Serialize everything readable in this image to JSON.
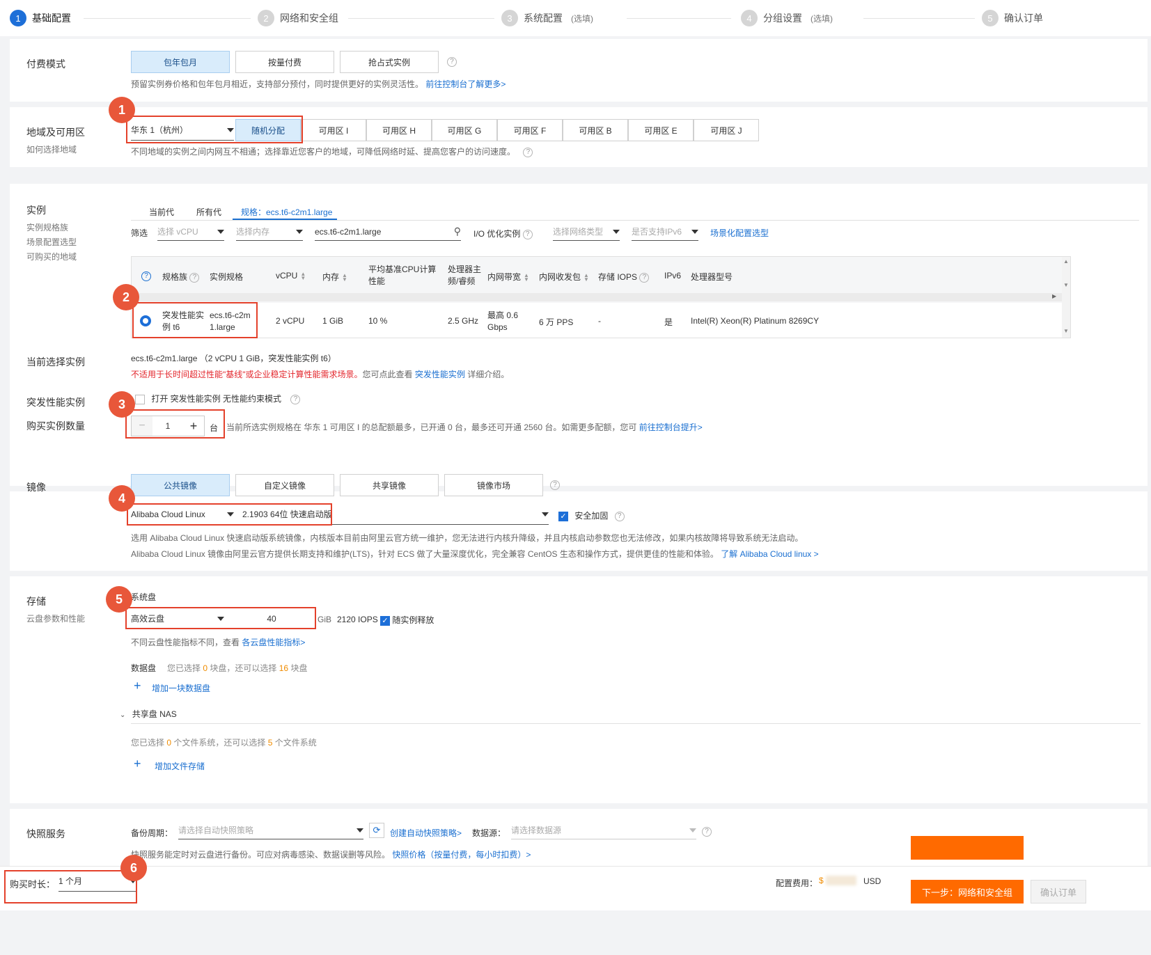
{
  "steps": [
    {
      "num": "1",
      "label": "基础配置",
      "optional": ""
    },
    {
      "num": "2",
      "label": "网络和安全组",
      "optional": ""
    },
    {
      "num": "3",
      "label": "系统配置",
      "optional": "(选填)"
    },
    {
      "num": "4",
      "label": "分组设置",
      "optional": "(选填)"
    },
    {
      "num": "5",
      "label": "确认订单",
      "optional": ""
    }
  ],
  "badges": [
    "1",
    "2",
    "3",
    "4",
    "5",
    "6"
  ],
  "billing": {
    "label": "付费模式",
    "options": [
      "包年包月",
      "按量付费",
      "抢占式实例"
    ],
    "hint": "预留实例券价格和包年包月相近，支持部分预付，同时提供更好的实例灵活性。",
    "hint_link": "前往控制台了解更多>"
  },
  "region": {
    "label": "地域及可用区",
    "sublabel": "如何选择地域",
    "region_value": "华东 1（杭州）",
    "zones": [
      "随机分配",
      "可用区 I",
      "可用区 H",
      "可用区 G",
      "可用区 F",
      "可用区 B",
      "可用区 E",
      "可用区 J"
    ],
    "hint": "不同地域的实例之间内网互不相通；选择靠近您客户的地域，可降低网络时延、提高您客户的访问速度。"
  },
  "instance": {
    "label": "实例",
    "sublabels": [
      "实例规格族",
      "场景配置选型",
      "可购买的地域"
    ],
    "tabs": [
      "当前代",
      "所有代",
      "规格：ecs.t6-c2m1.large"
    ],
    "filter_label": "筛选",
    "filter_vcpu": "选择 vCPU",
    "filter_mem": "选择内存",
    "search_value": "ecs.t6-c2m1.large",
    "io_label": "I/O 优化实例",
    "filter_net": "选择网络类型",
    "filter_ipv6": "是否支持IPv6",
    "scene_link": "场景化配置选型",
    "columns": [
      "规格族",
      "实例规格",
      "vCPU",
      "内存",
      "平均基准CPU计算性能",
      "处理器主频/睿频",
      "内网带宽",
      "内网收发包",
      "存储 IOPS",
      "IPv6",
      "处理器型号"
    ],
    "row": {
      "family": "突发性能实例 t6",
      "spec": "ecs.t6-c2m1.large",
      "vcpu": "2 vCPU",
      "mem": "1 GiB",
      "baseline": "10 %",
      "freq": "2.5 GHz",
      "bandwidth": "最高 0.6 Gbps",
      "pps": "6 万 PPS",
      "iops": "-",
      "ipv6": "是",
      "cpu": "Intel(R) Xeon(R) Platinum 8269CY"
    }
  },
  "current": {
    "label": "当前选择实例",
    "value": "ecs.t6-c2m1.large （2 vCPU 1 GiB，突发性能实例 t6）",
    "warn": "不适用于长时间超过性能\"基线\"或企业稳定计算性能需求场景。",
    "warn_tail": "您可点此查看",
    "warn_link": "突发性能实例",
    "warn_end": "详细介绍。"
  },
  "burst": {
    "label": "突发性能实例",
    "checkbox_text": "打开 突发性能实例 无性能约束模式"
  },
  "quantity": {
    "label": "购买实例数量",
    "value": "1",
    "unit": "台",
    "hint": "当前所选实例规格在 华东 1 可用区 I 的总配额最多，已开通 0 台，最多还可开通 2560 台。如需更多配额，您可",
    "hint_link": "前往控制台提升>"
  },
  "image": {
    "label": "镜像",
    "tabs": [
      "公共镜像",
      "自定义镜像",
      "共享镜像",
      "镜像市场"
    ],
    "os": "Alibaba Cloud Linux",
    "version": "2.1903 64位 快速启动版",
    "security": "安全加固",
    "desc1": "选用 Alibaba Cloud Linux 快速启动版系统镜像，内核版本目前由阿里云官方统一维护，您无法进行内核升降级，并且内核启动参数您也无法修改，如果内核故障将导致系统无法启动。",
    "desc2": "Alibaba Cloud Linux 镜像由阿里云官方提供长期支持和维护(LTS)，针对 ECS 做了大量深度优化，完全兼容 CentOS 生态和操作方式，提供更佳的性能和体验。",
    "desc2_link": "了解 Alibaba Cloud linux >"
  },
  "storage": {
    "label": "存储",
    "sublabel": "云盘参数和性能",
    "sys_label": "系统盘",
    "disk_type": "高效云盘",
    "size": "40",
    "unit": "GiB",
    "iops": "2120 IOPS",
    "release": "随实例释放",
    "perf_hint": "不同云盘性能指标不同，查看",
    "perf_link": "各云盘性能指标>",
    "data_label": "数据盘",
    "data_hint_a": "您已选择",
    "data_selected": "0",
    "data_hint_b": "块盘，还可以选择",
    "data_remain": "16",
    "data_hint_c": "块盘",
    "add_disk": "增加一块数据盘",
    "nas_label": "共享盘 NAS",
    "nas_hint_a": "您已选择",
    "nas_selected": "0",
    "nas_hint_b": "个文件系统，还可以选择",
    "nas_remain": "5",
    "nas_hint_c": "个文件系统",
    "add_nas": "增加文件存储"
  },
  "snapshot": {
    "label": "快照服务",
    "period_label": "备份周期：",
    "period_placeholder": "请选择自动快照策略",
    "create_link": "创建自动快照策略>",
    "source_label": "数据源：",
    "source_placeholder": "请选择数据源",
    "hint": "快照服务能定时对云盘进行备份。可应对病毒感染、数据误删等风险。",
    "hint_link": "快照价格（按量付费，每小时扣费）>"
  },
  "footer": {
    "duration_label": "购买时长：",
    "duration_value": "1 个月",
    "fee_label": "配置费用：",
    "fee_prefix": "$",
    "fee_currency": "USD",
    "next_button": "下一步：网络和安全组",
    "confirm_button": "确认订单"
  }
}
